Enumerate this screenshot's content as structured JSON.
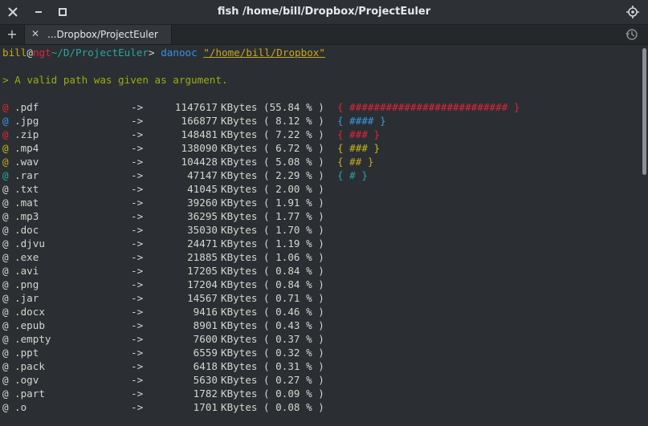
{
  "window": {
    "title": "fish  /home/bill/Dropbox/ProjectEuler",
    "close_icon": "close-icon",
    "minimize_icon": "minimize-icon",
    "maximize_icon": "maximize-icon",
    "menu_icon": "window-menu-icon"
  },
  "tabs": {
    "new_tab_symbol": "+",
    "items": [
      {
        "label": "...Dropbox/ProjectEuler",
        "close_symbol": "✕"
      }
    ],
    "history_icon": "history-icon"
  },
  "terminal": {
    "prompt": {
      "user": "bill",
      "at": "@",
      "host": "ngt",
      "path": "~/D/ProjectEuler",
      "symbol": ">",
      "command": "danooc",
      "argument": "\"/home/bill/Dropbox\""
    },
    "message": "> A valid path was given as argument.",
    "rows": [
      {
        "marker": "@",
        "ext": ".pdf",
        "arrow": "->",
        "size": "1147617",
        "unit": "KBytes",
        "pct": "(55.84 % )",
        "bar": "{ ########################## }",
        "color": "#e0243b"
      },
      {
        "marker": "@",
        "ext": ".jpg",
        "arrow": "->",
        "size": "166877",
        "unit": "KBytes",
        "pct": "( 8.12 % )",
        "bar": "{ #### }",
        "color": "#3a98e2"
      },
      {
        "marker": "@",
        "ext": ".zip",
        "arrow": "->",
        "size": "148481",
        "unit": "KBytes",
        "pct": "( 7.22 % )",
        "bar": "{ ### }",
        "color": "#e0243b"
      },
      {
        "marker": "@",
        "ext": ".mp4",
        "arrow": "->",
        "size": "138090",
        "unit": "KBytes",
        "pct": "( 6.72 % )",
        "bar": "{ ### }",
        "color": "#c7b818"
      },
      {
        "marker": "@",
        "ext": ".wav",
        "arrow": "->",
        "size": "104428",
        "unit": "KBytes",
        "pct": "( 5.08 % )",
        "bar": "{ ## }",
        "color": "#c7a81a"
      },
      {
        "marker": "@",
        "ext": ".rar",
        "arrow": "->",
        "size": "47147",
        "unit": "KBytes",
        "pct": "( 2.29 % )",
        "bar": "{ # }",
        "color": "#27a6a0"
      },
      {
        "marker": "@",
        "ext": ".txt",
        "arrow": "->",
        "size": "41045",
        "unit": "KBytes",
        "pct": "( 2.00 % )",
        "bar": "",
        "color": "#d3d7cf"
      },
      {
        "marker": "@",
        "ext": ".mat",
        "arrow": "->",
        "size": "39260",
        "unit": "KBytes",
        "pct": "( 1.91 % )",
        "bar": "",
        "color": "#d3d7cf"
      },
      {
        "marker": "@",
        "ext": ".mp3",
        "arrow": "->",
        "size": "36295",
        "unit": "KBytes",
        "pct": "( 1.77 % )",
        "bar": "",
        "color": "#d3d7cf"
      },
      {
        "marker": "@",
        "ext": ".doc",
        "arrow": "->",
        "size": "35030",
        "unit": "KBytes",
        "pct": "( 1.70 % )",
        "bar": "",
        "color": "#d3d7cf"
      },
      {
        "marker": "@",
        "ext": ".djvu",
        "arrow": "->",
        "size": "24471",
        "unit": "KBytes",
        "pct": "( 1.19 % )",
        "bar": "",
        "color": "#d3d7cf"
      },
      {
        "marker": "@",
        "ext": ".exe",
        "arrow": "->",
        "size": "21885",
        "unit": "KBytes",
        "pct": "( 1.06 % )",
        "bar": "",
        "color": "#d3d7cf"
      },
      {
        "marker": "@",
        "ext": ".avi",
        "arrow": "->",
        "size": "17205",
        "unit": "KBytes",
        "pct": "( 0.84 % )",
        "bar": "",
        "color": "#d3d7cf"
      },
      {
        "marker": "@",
        "ext": ".png",
        "arrow": "->",
        "size": "17204",
        "unit": "KBytes",
        "pct": "( 0.84 % )",
        "bar": "",
        "color": "#d3d7cf"
      },
      {
        "marker": "@",
        "ext": ".jar",
        "arrow": "->",
        "size": "14567",
        "unit": "KBytes",
        "pct": "( 0.71 % )",
        "bar": "",
        "color": "#d3d7cf"
      },
      {
        "marker": "@",
        "ext": ".docx",
        "arrow": "->",
        "size": "9416",
        "unit": "KBytes",
        "pct": "( 0.46 % )",
        "bar": "",
        "color": "#d3d7cf"
      },
      {
        "marker": "@",
        "ext": ".epub",
        "arrow": "->",
        "size": "8901",
        "unit": "KBytes",
        "pct": "( 0.43 % )",
        "bar": "",
        "color": "#d3d7cf"
      },
      {
        "marker": "@",
        "ext": ".empty",
        "arrow": "->",
        "size": "7600",
        "unit": "KBytes",
        "pct": "( 0.37 % )",
        "bar": "",
        "color": "#d3d7cf"
      },
      {
        "marker": "@",
        "ext": ".ppt",
        "arrow": "->",
        "size": "6559",
        "unit": "KBytes",
        "pct": "( 0.32 % )",
        "bar": "",
        "color": "#d3d7cf"
      },
      {
        "marker": "@",
        "ext": ".pack",
        "arrow": "->",
        "size": "6418",
        "unit": "KBytes",
        "pct": "( 0.31 % )",
        "bar": "",
        "color": "#d3d7cf"
      },
      {
        "marker": "@",
        "ext": ".ogv",
        "arrow": "->",
        "size": "5630",
        "unit": "KBytes",
        "pct": "( 0.27 % )",
        "bar": "",
        "color": "#d3d7cf"
      },
      {
        "marker": "@",
        "ext": ".part",
        "arrow": "->",
        "size": "1782",
        "unit": "KBytes",
        "pct": "( 0.09 % )",
        "bar": "",
        "color": "#d3d7cf"
      },
      {
        "marker": "@",
        "ext": ".o",
        "arrow": "->",
        "size": "1701",
        "unit": "KBytes",
        "pct": "( 0.08 % )",
        "bar": "",
        "color": "#d3d7cf"
      }
    ]
  }
}
